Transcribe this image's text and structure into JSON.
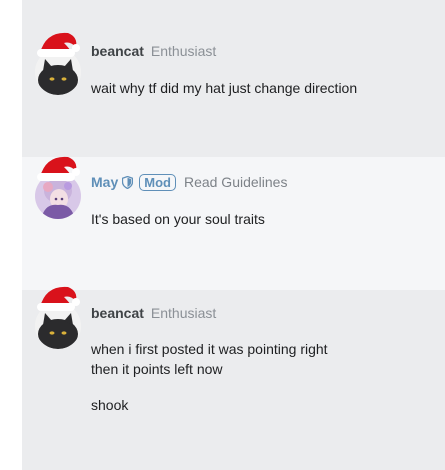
{
  "posts": [
    {
      "username": "beancat",
      "user_title": "Enthusiast",
      "body": "wait why tf did my hat just change direction"
    },
    {
      "username": "May",
      "badge": "Mod",
      "link": "Read Guidelines",
      "body": "It's based on your soul traits"
    },
    {
      "username": "beancat",
      "user_title": "Enthusiast",
      "body_line1": "when i first posted it was pointing right",
      "body_line2": "then it points left now",
      "body_line3": "shook"
    }
  ],
  "colors": {
    "post_bg_grey": "#ebecee",
    "post_bg_light": "#f5f6f8",
    "mod_accent": "#5f8fb8",
    "hat_red": "#d9121b"
  },
  "icons": {
    "hat": "santa-hat-icon",
    "shield": "moderator-shield-icon"
  }
}
